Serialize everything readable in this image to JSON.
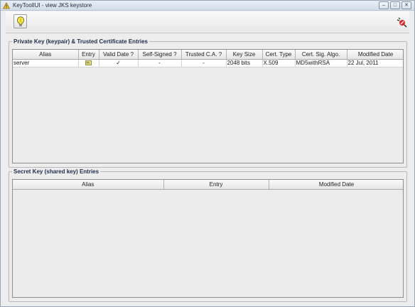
{
  "window": {
    "title": "KeyToolIUI - view JKS keystore",
    "controls": [
      "–",
      "□",
      "✕"
    ]
  },
  "toolbar": {
    "left_button_icon": "lightbulb-icon",
    "right_icon": "keytool-logo-icon"
  },
  "private_section": {
    "title": "Private Key (keypair) & Trusted Certificate Entries",
    "columns": [
      "Alias",
      "Entry",
      "Valid Date ?",
      "Self-Signed ?",
      "Trusted C.A. ?",
      "Key Size",
      "Cert. Type",
      "Cert. Sig. Algo.",
      "Modified Date"
    ],
    "rows": [
      {
        "alias": "server",
        "entry_icon": "certificate-icon",
        "valid_date": "✓",
        "self_signed": "-",
        "trusted_ca": "-",
        "key_size": "2048 bits",
        "cert_type": "X.509",
        "sig_algo": "MD5withRSA",
        "modified_date": "22 Jul, 2011"
      }
    ]
  },
  "secret_section": {
    "title": "Secret Key (shared key) Entries",
    "columns": [
      "Alias",
      "Entry",
      "Modified Date"
    ],
    "rows": []
  }
}
